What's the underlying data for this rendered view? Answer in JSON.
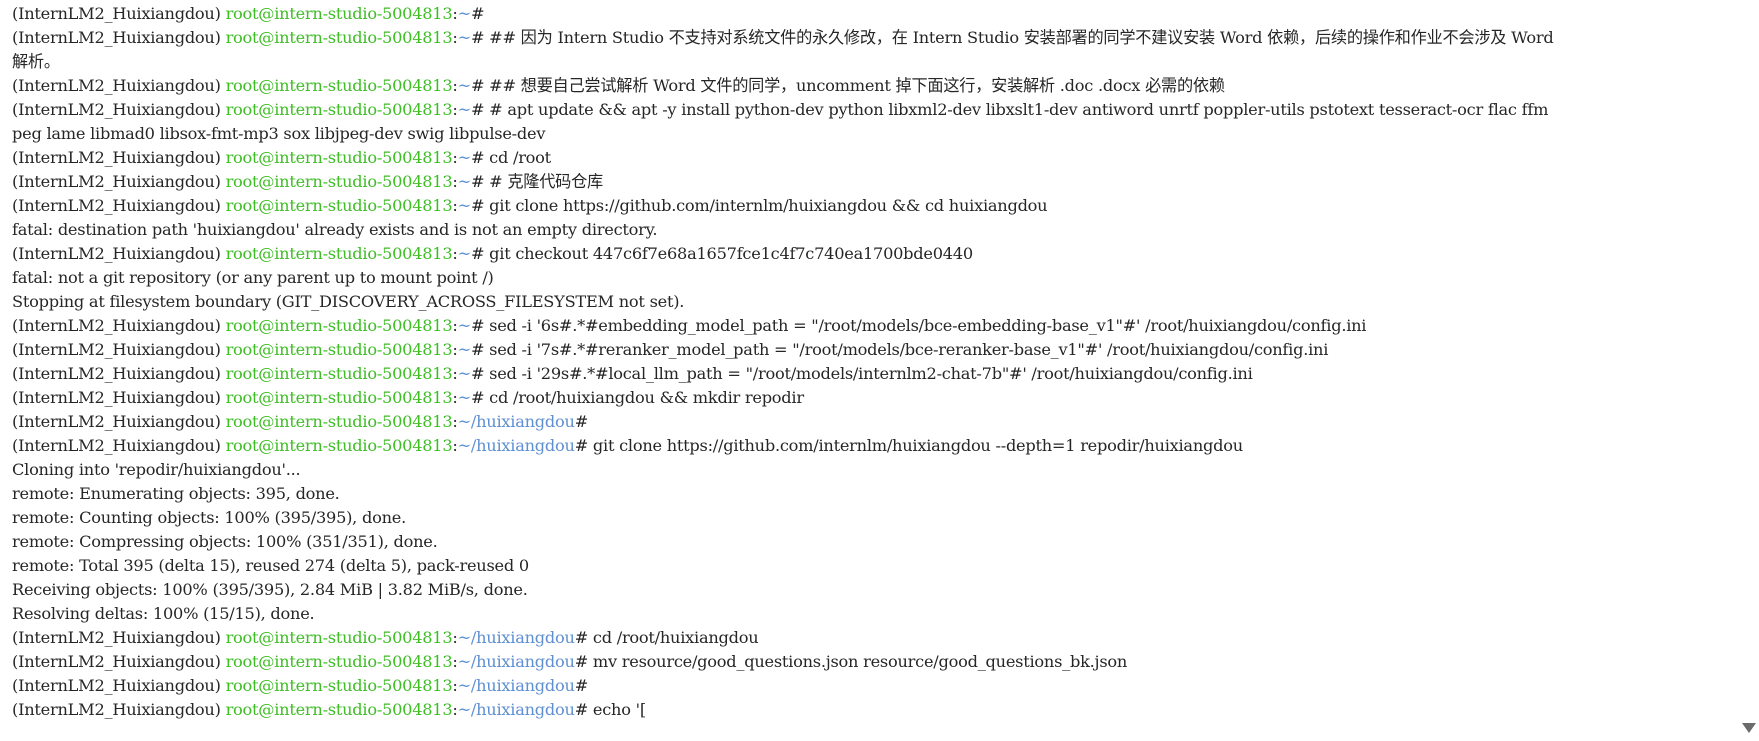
{
  "prompt": {
    "env": "(InternLM2_Huixiangdou) ",
    "userhost": "root@intern-studio-5004813",
    "colon": ":",
    "hash": "#"
  },
  "lines": [
    {
      "type": "prompt",
      "path": "~",
      "cmd": ""
    },
    {
      "type": "prompt",
      "path": "~",
      "cmd": " ## 因为 Intern Studio 不支持对系统文件的永久修改，在 Intern Studio 安装部署的同学不建议安装 Word 依赖，后续的操作和作业不会涉及 Word"
    },
    {
      "type": "output",
      "text": "解析。"
    },
    {
      "type": "prompt",
      "path": "~",
      "cmd": " ## 想要自己尝试解析 Word 文件的同学，uncomment 掉下面这行，安装解析 .doc .docx 必需的依赖"
    },
    {
      "type": "prompt",
      "path": "~",
      "cmd": " # apt update && apt -y install python-dev python libxml2-dev libxslt1-dev antiword unrtf poppler-utils pstotext tesseract-ocr flac ffm"
    },
    {
      "type": "output",
      "text": "peg lame libmad0 libsox-fmt-mp3 sox libjpeg-dev swig libpulse-dev"
    },
    {
      "type": "prompt",
      "path": "~",
      "cmd": " cd /root"
    },
    {
      "type": "prompt",
      "path": "~",
      "cmd": " # 克隆代码仓库"
    },
    {
      "type": "prompt",
      "path": "~",
      "cmd": " git clone https://github.com/internlm/huixiangdou && cd huixiangdou"
    },
    {
      "type": "output",
      "text": "fatal: destination path 'huixiangdou' already exists and is not an empty directory."
    },
    {
      "type": "prompt",
      "path": "~",
      "cmd": " git checkout 447c6f7e68a1657fce1c4f7c740ea1700bde0440"
    },
    {
      "type": "output",
      "text": "fatal: not a git repository (or any parent up to mount point /)"
    },
    {
      "type": "output",
      "text": "Stopping at filesystem boundary (GIT_DISCOVERY_ACROSS_FILESYSTEM not set)."
    },
    {
      "type": "prompt",
      "path": "~",
      "cmd": " sed -i '6s#.*#embedding_model_path = \"/root/models/bce-embedding-base_v1\"#' /root/huixiangdou/config.ini"
    },
    {
      "type": "prompt",
      "path": "~",
      "cmd": " sed -i '7s#.*#reranker_model_path = \"/root/models/bce-reranker-base_v1\"#' /root/huixiangdou/config.ini"
    },
    {
      "type": "prompt",
      "path": "~",
      "cmd": " sed -i '29s#.*#local_llm_path = \"/root/models/internlm2-chat-7b\"#' /root/huixiangdou/config.ini"
    },
    {
      "type": "prompt",
      "path": "~",
      "cmd": " cd /root/huixiangdou && mkdir repodir"
    },
    {
      "type": "prompt",
      "path": "~/huixiangdou",
      "cmd": ""
    },
    {
      "type": "prompt",
      "path": "~/huixiangdou",
      "cmd": " git clone https://github.com/internlm/huixiangdou --depth=1 repodir/huixiangdou"
    },
    {
      "type": "output",
      "text": "Cloning into 'repodir/huixiangdou'..."
    },
    {
      "type": "output",
      "text": "remote: Enumerating objects: 395, done."
    },
    {
      "type": "output",
      "text": "remote: Counting objects: 100% (395/395), done."
    },
    {
      "type": "output",
      "text": "remote: Compressing objects: 100% (351/351), done."
    },
    {
      "type": "output",
      "text": "remote: Total 395 (delta 15), reused 274 (delta 5), pack-reused 0"
    },
    {
      "type": "output",
      "text": "Receiving objects: 100% (395/395), 2.84 MiB | 3.82 MiB/s, done."
    },
    {
      "type": "output",
      "text": "Resolving deltas: 100% (15/15), done."
    },
    {
      "type": "prompt",
      "path": "~/huixiangdou",
      "cmd": " cd /root/huixiangdou"
    },
    {
      "type": "prompt",
      "path": "~/huixiangdou",
      "cmd": " mv resource/good_questions.json resource/good_questions_bk.json"
    },
    {
      "type": "prompt",
      "path": "~/huixiangdou",
      "cmd": ""
    },
    {
      "type": "prompt",
      "path": "~/huixiangdou",
      "cmd": " echo '["
    }
  ],
  "colors": {
    "background": "#ffffff",
    "text": "#262626",
    "userhost": "#3ebd24",
    "path": "#5d8fd1"
  },
  "icons": {
    "scroll_down": "triangle-down"
  }
}
